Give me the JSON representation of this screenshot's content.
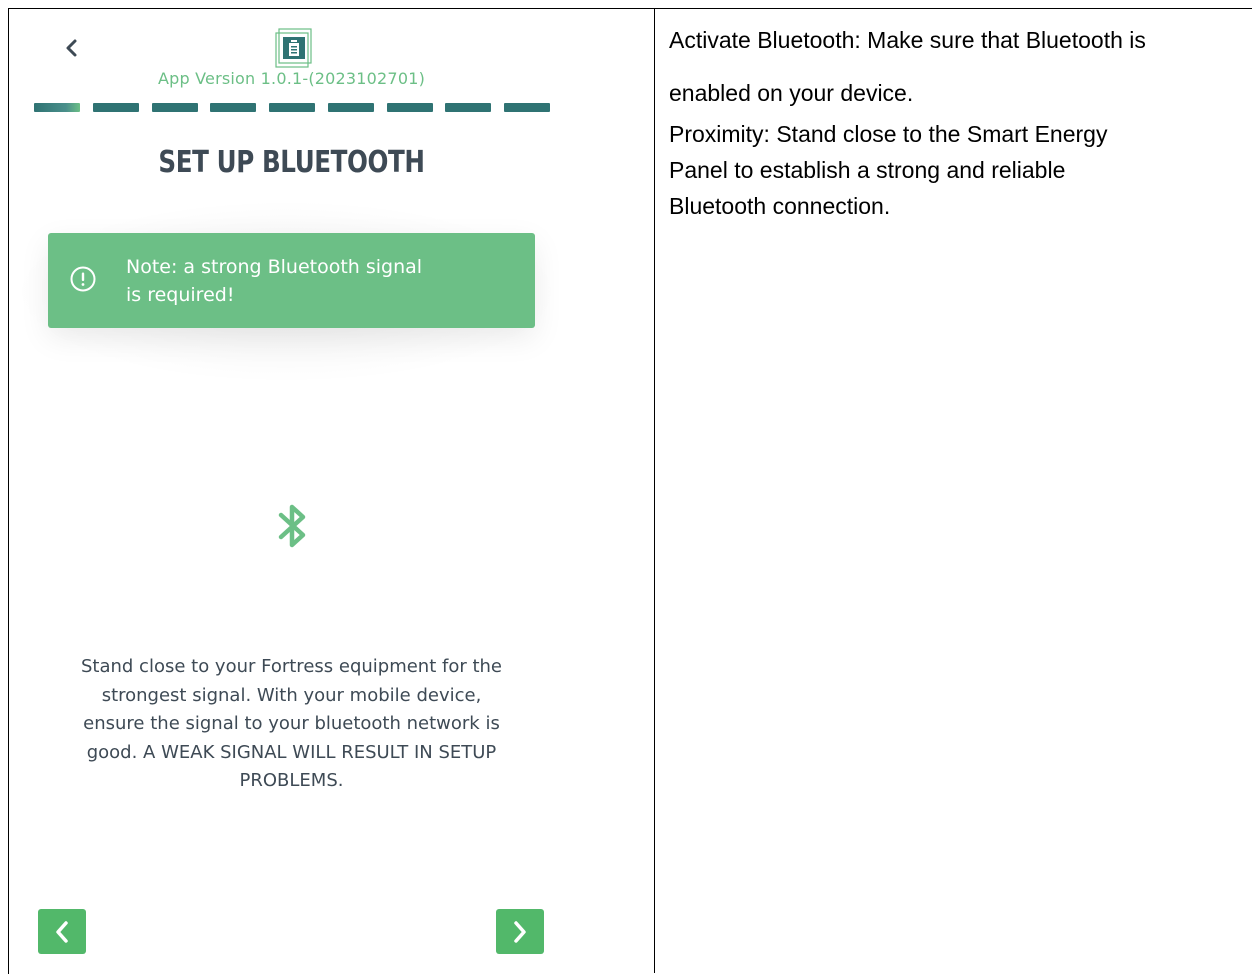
{
  "phone": {
    "app_version": "App Version 1.0.1-(2023102701)",
    "progress": {
      "total_steps": 9,
      "current_step": 1
    },
    "title": "SET UP BLUETOOTH",
    "note": {
      "icon": "exclamation-circle-icon",
      "line1": "Note: a strong Bluetooth signal",
      "line2": "is required!"
    },
    "instructions": [
      "Stand close to your Fortress equipment for the",
      "strongest signal. With your mobile device,",
      "ensure the signal to your bluetooth network is",
      "good. A WEAK SIGNAL WILL RESULT IN SETUP",
      "PROBLEMS."
    ],
    "icons": {
      "back": "chevron-left-icon",
      "logo": "app-logo-icon",
      "bluetooth": "bluetooth-icon",
      "prev": "chevron-left-icon",
      "next": "chevron-right-icon"
    },
    "colors": {
      "accent_green": "#6cbf86",
      "button_green": "#52b86a",
      "progress_teal": "#2f7373",
      "text_dark": "#3e4a55"
    }
  },
  "doc": {
    "line1": "Activate Bluetooth: Make sure that Bluetooth is",
    "line2": "enabled on your device.",
    "para2_line1": "Proximity: Stand close to the Smart Energy",
    "para2_line2": "Panel to establish a strong and reliable",
    "para2_line3": "Bluetooth connection."
  }
}
